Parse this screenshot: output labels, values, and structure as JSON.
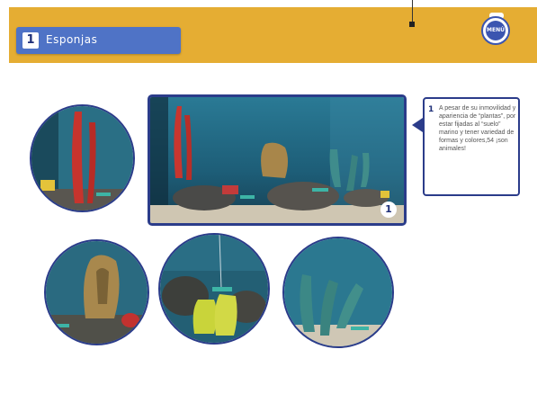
{
  "header": {
    "section_number": "1",
    "section_title": "Esponjas",
    "menu_label": "MENÚ"
  },
  "main_photo": {
    "badge": "1"
  },
  "info_card": {
    "number": "1",
    "text": "A pesar de su inmovilidad y apariencia de “plantas”, por estar fijadas al “suelo” marino y tener variedad de formas y colores,54 ¡son animales!"
  },
  "colors": {
    "header_band": "#e5ad33",
    "title_pill": "#4f73c6",
    "frame_border": "#2b3c8a",
    "aquarium_water": "#1f5d78"
  }
}
